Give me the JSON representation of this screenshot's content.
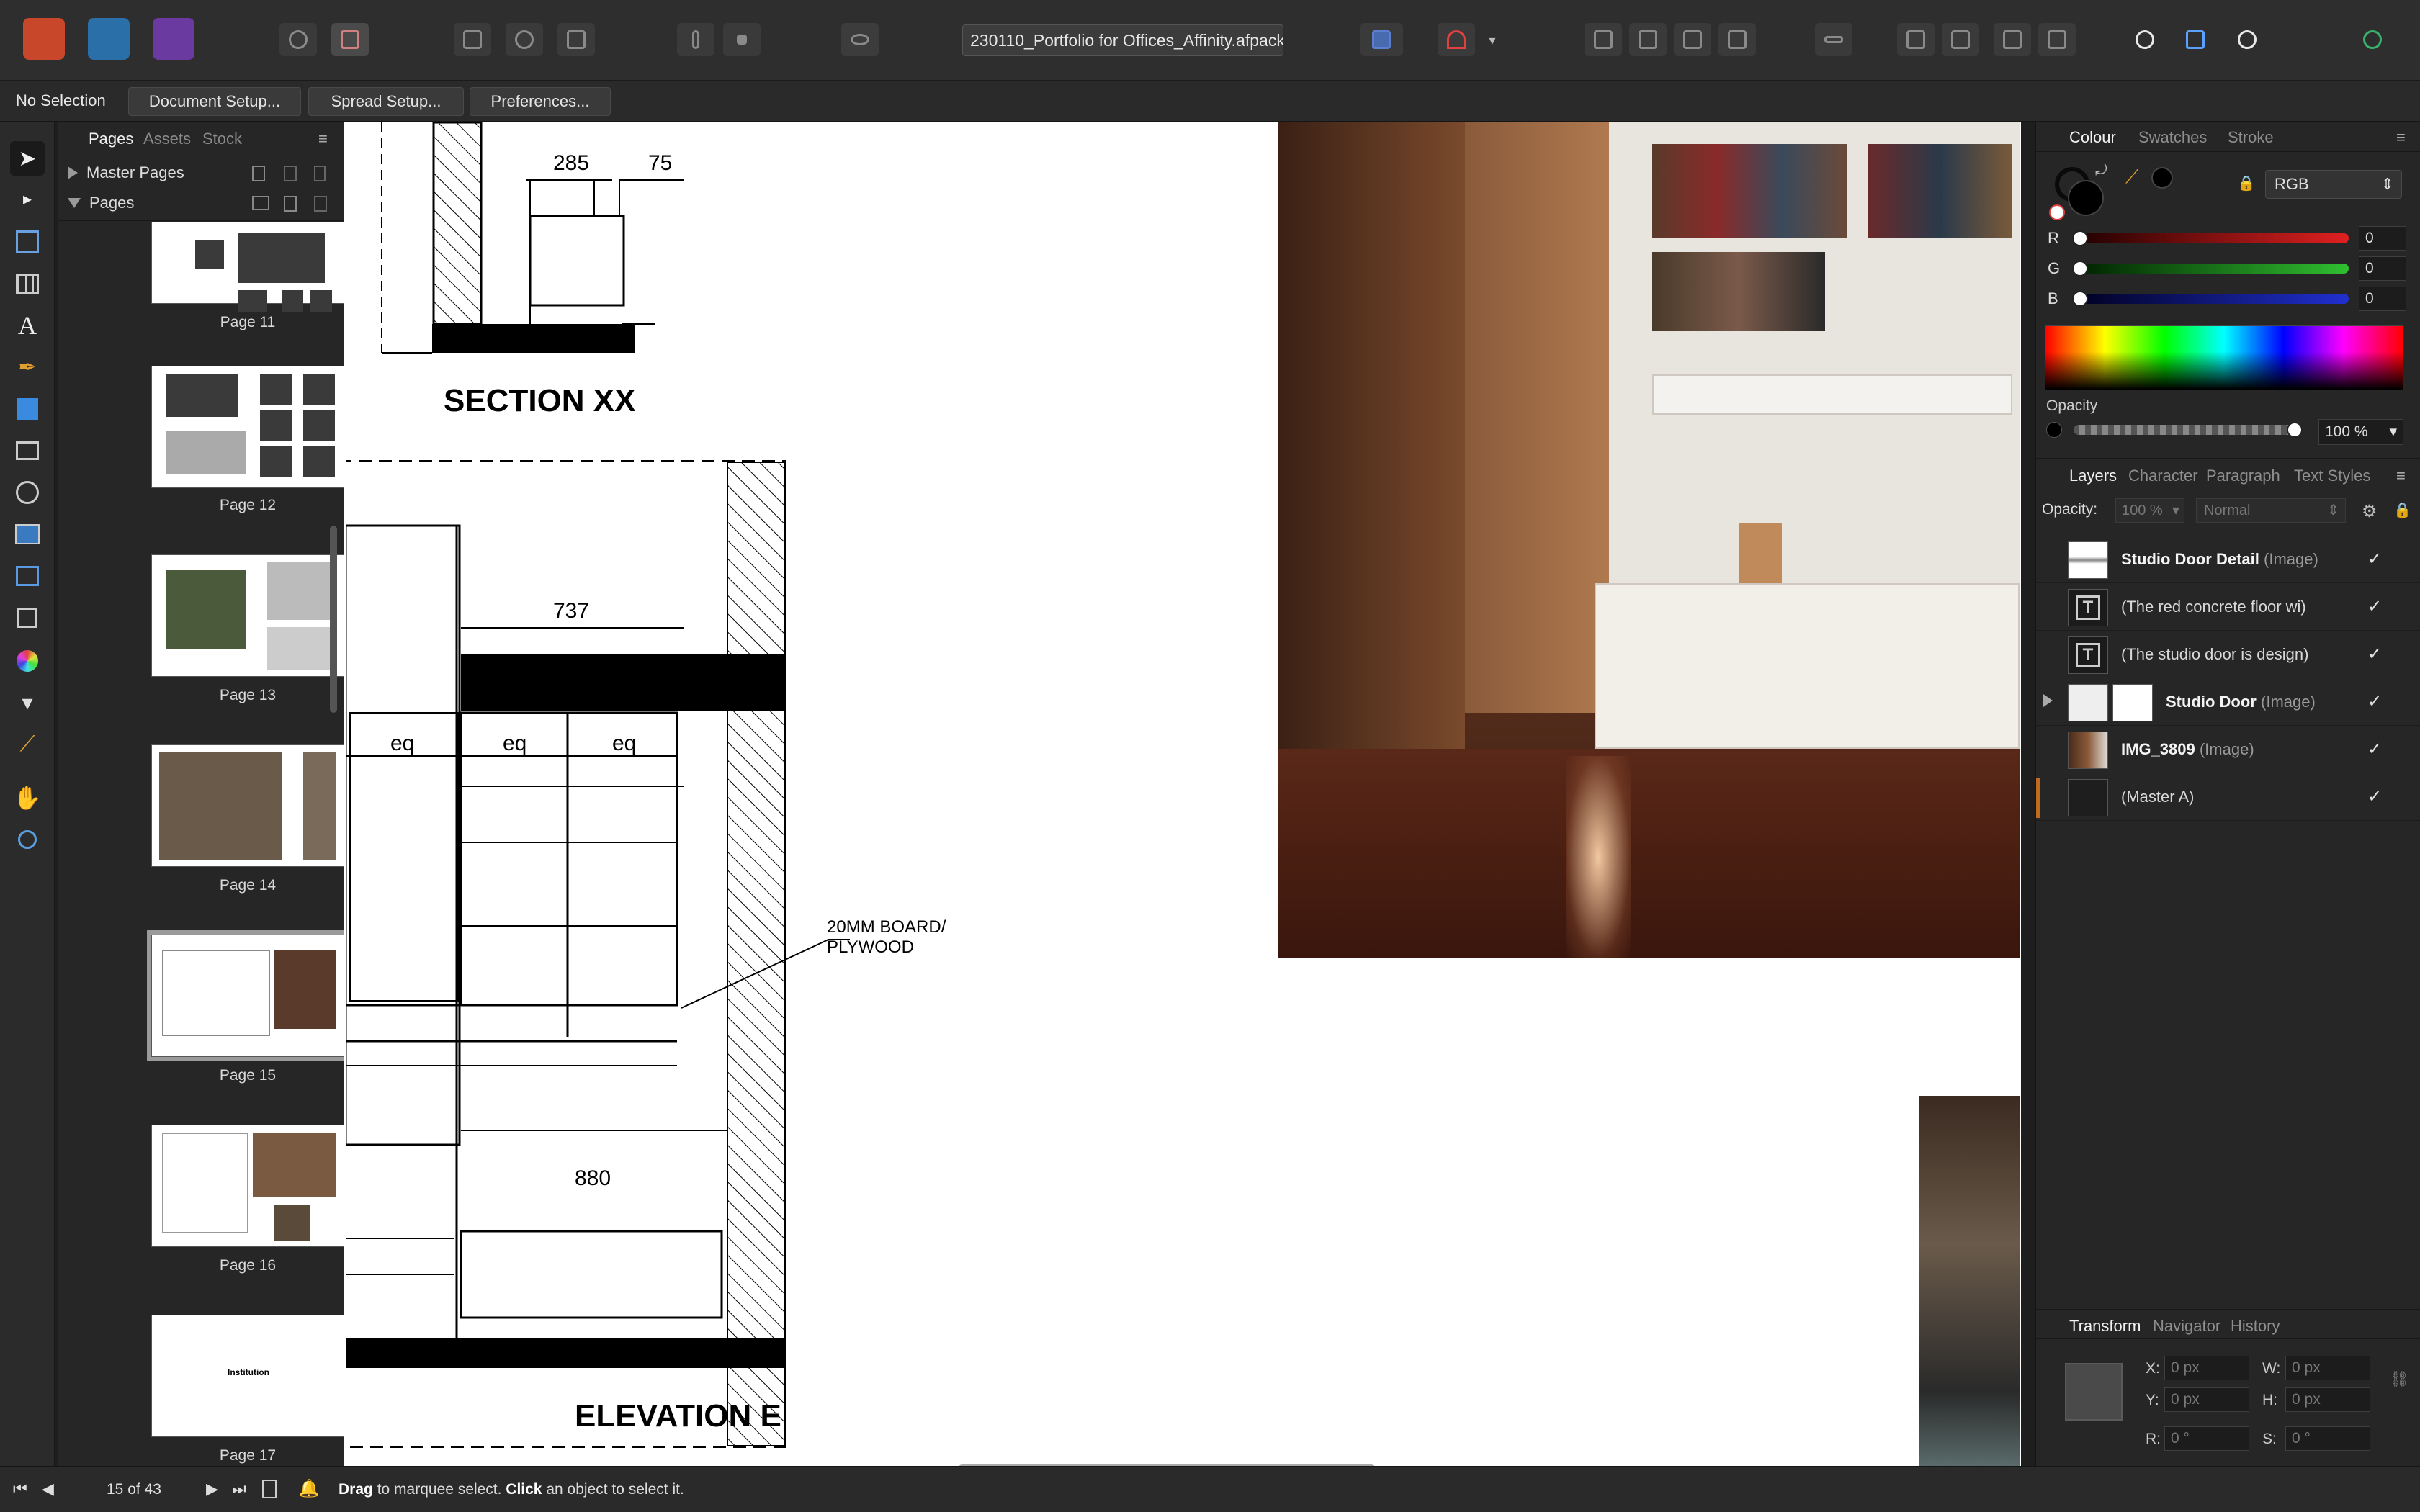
{
  "toolbar": {
    "apps": [
      "affinity-publisher-icon",
      "affinity-designer-persona-icon",
      "affinity-photo-persona-icon"
    ],
    "filename": "230110_Portfolio for Offices_Affinity.afpackage"
  },
  "context_bar": {
    "status": "No Selection",
    "buttons": [
      "Document Setup...",
      "Spread Setup...",
      "Preferences..."
    ]
  },
  "pages_panel": {
    "tabs": [
      "Pages",
      "Assets",
      "Stock"
    ],
    "master_pages_label": "Master Pages",
    "pages_label": "Pages",
    "pages": [
      {
        "label": "Page 11"
      },
      {
        "label": "Page 12"
      },
      {
        "label": "Page 13"
      },
      {
        "label": "Page 14"
      },
      {
        "label": "Page 15",
        "selected": true
      },
      {
        "label": "Page 16"
      },
      {
        "label": "Page 17",
        "thumb_text": "Institution"
      }
    ]
  },
  "canvas": {
    "dims": [
      "285",
      "75",
      "737",
      "eq",
      "eq",
      "eq",
      "880"
    ],
    "section_title": "SECTION XX",
    "elevation_title": "ELEVATION E",
    "note_line1": "20MM BOARD/",
    "note_line2": "PLYWOOD"
  },
  "colour_panel": {
    "tabs": [
      "Colour",
      "Swatches",
      "Stroke"
    ],
    "model": "RGB",
    "channels": [
      {
        "label": "R",
        "value": "0",
        "color": "#d02020"
      },
      {
        "label": "G",
        "value": "0",
        "color": "#28b028"
      },
      {
        "label": "B",
        "value": "0",
        "color": "#2030c8"
      }
    ],
    "opacity_label": "Opacity",
    "opacity_value": "100 %"
  },
  "layers_panel": {
    "tabs": [
      "Layers",
      "Character",
      "Paragraph",
      "Text Styles"
    ],
    "opacity_label": "Opacity:",
    "opacity_value": "100 %",
    "blend_mode": "Normal",
    "layers": [
      {
        "name": "Studio Door Detail",
        "kind": "(Image)",
        "bold": true
      },
      {
        "name": "(The red concrete floor wi)",
        "kind": "",
        "bold": false
      },
      {
        "name": "(The studio door is design)",
        "kind": "",
        "bold": false
      },
      {
        "name": "Studio Door",
        "kind": "(Image)",
        "bold": true
      },
      {
        "name": "IMG_3809",
        "kind": "(Image)",
        "bold": true
      },
      {
        "name": "(Master A)",
        "kind": "",
        "bold": false
      }
    ]
  },
  "transform_panel": {
    "tabs": [
      "Transform",
      "Navigator",
      "History"
    ],
    "x_label": "X:",
    "x_value": "0 px",
    "y_label": "Y:",
    "y_value": "0 px",
    "w_label": "W:",
    "w_value": "0 px",
    "h_label": "H:",
    "h_value": "0 px",
    "r_label": "R:",
    "r_value": "0 °",
    "s_label": "S:",
    "s_value": "0 °"
  },
  "status_bar": {
    "page_count": "15 of 43",
    "hint_drag": "Drag",
    "hint_mid": " to marquee select. ",
    "hint_click": "Click",
    "hint_end": " an object to select it."
  }
}
